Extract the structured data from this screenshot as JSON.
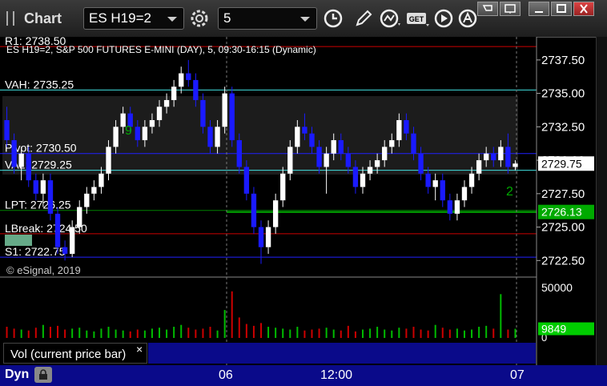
{
  "window": {
    "title": "Chart",
    "symbol": "ES H19=2",
    "interval": "5",
    "window_buttons": [
      "pin-icon",
      "restore-icon",
      "minimize-icon",
      "maximize-icon",
      "close-icon"
    ]
  },
  "toolbar": {
    "icons": [
      "settings-gear-icon",
      "clock-icon",
      "pencil-icon",
      "study-icon",
      "get-icon",
      "play-icon",
      "alert-icon"
    ],
    "get_label": "GET"
  },
  "chart": {
    "header": "ES H19=2, S&P 500 FUTURES E-MINI (DAY), 5, 09:30-16:15 (Dynamic)",
    "watermark": "© eSignal, 2019",
    "level_labels": [
      {
        "text": "R1: 2738.50",
        "price": 2738.5,
        "color": "#cc0000"
      },
      {
        "text": "VAH: 2735.25",
        "price": 2735.25,
        "color": "#40e0e0"
      },
      {
        "text": "Pivot: 2730.50",
        "price": 2730.5,
        "color": "#2020ff"
      },
      {
        "text": "VAL: 2729.25",
        "price": 2729.25,
        "color": "#40e0e0"
      },
      {
        "text": "LPT: 2726.25",
        "price": 2726.25,
        "color": "#008000"
      },
      {
        "text": "LBreak: 2724.50",
        "price": 2724.5,
        "color": "#cc0000"
      },
      {
        "text": "S1: 2722.75",
        "price": 2722.75,
        "color": "#2020ff"
      }
    ],
    "price_ticks": [
      "2737.50",
      "2735.00",
      "2732.50",
      "2730.00",
      "2727.50",
      "2725.00",
      "2722.50"
    ],
    "last_price": "2729.75",
    "green_level": "2726.13",
    "volume_tick": "50000",
    "volume_zero": "0",
    "volume_last": "9849",
    "time_ticks": [
      "06",
      "12:00",
      "07"
    ],
    "count_labels": [
      "9",
      "2"
    ]
  },
  "panel": {
    "vol_tab": "Vol (current price bar)",
    "close": "×",
    "dyn_label": "Dyn"
  },
  "chart_data": {
    "type": "candlestick",
    "y_range": [
      2721.5,
      2738.75
    ],
    "candles": [
      [
        2733,
        2734,
        2731,
        2731.5
      ],
      [
        2731.5,
        2732,
        2729,
        2729.5
      ],
      [
        2729.5,
        2731,
        2728.5,
        2730.5
      ],
      [
        2730.5,
        2731,
        2728,
        2728.5
      ],
      [
        2728.5,
        2729,
        2727,
        2727.5
      ],
      [
        2727.5,
        2729,
        2726.5,
        2728.5
      ],
      [
        2728.5,
        2729,
        2725.5,
        2726
      ],
      [
        2726,
        2726.5,
        2723,
        2723.5
      ],
      [
        2723.5,
        2724,
        2722.5,
        2723
      ],
      [
        2723,
        2725.5,
        2722.75,
        2725
      ],
      [
        2725,
        2727,
        2724.5,
        2726.5
      ],
      [
        2726.5,
        2728,
        2726,
        2727.5
      ],
      [
        2727.5,
        2728.5,
        2727,
        2728
      ],
      [
        2728,
        2729.5,
        2727.5,
        2729
      ],
      [
        2729,
        2731.5,
        2728.5,
        2731
      ],
      [
        2731,
        2733,
        2730.5,
        2732.5
      ],
      [
        2732.5,
        2734,
        2732,
        2733.5
      ],
      [
        2733.5,
        2734,
        2732,
        2732.5
      ],
      [
        2732.5,
        2733,
        2731,
        2731.5
      ],
      [
        2731.5,
        2733,
        2731,
        2732.5
      ],
      [
        2732.5,
        2733.5,
        2732,
        2733
      ],
      [
        2733,
        2734.5,
        2732.5,
        2734
      ],
      [
        2734,
        2735,
        2733.5,
        2734.5
      ],
      [
        2734.5,
        2736,
        2734,
        2735.5
      ],
      [
        2735.5,
        2737,
        2735,
        2736.5
      ],
      [
        2736.5,
        2737.5,
        2735.5,
        2736
      ],
      [
        2736,
        2736.5,
        2734,
        2734.5
      ],
      [
        2734.5,
        2735,
        2732,
        2732.5
      ],
      [
        2732.5,
        2733,
        2730.5,
        2731
      ],
      [
        2731,
        2733,
        2730.5,
        2732.5
      ],
      [
        2732.5,
        2735.5,
        2732,
        2735
      ],
      [
        2735,
        2735.5,
        2731,
        2731.5
      ],
      [
        2731.5,
        2732,
        2729,
        2729.5
      ],
      [
        2729.5,
        2730,
        2727,
        2727.5
      ],
      [
        2727.5,
        2728,
        2724.5,
        2725
      ],
      [
        2725,
        2725.5,
        2722.25,
        2723.5
      ],
      [
        2723.5,
        2725.5,
        2723,
        2725
      ],
      [
        2725,
        2727.5,
        2724.5,
        2727
      ],
      [
        2727,
        2729.5,
        2726.5,
        2729
      ],
      [
        2729,
        2731.5,
        2728.5,
        2731
      ],
      [
        2731,
        2733,
        2730.5,
        2732.5
      ],
      [
        2732.5,
        2733.5,
        2731.5,
        2732
      ],
      [
        2732,
        2732.5,
        2730.5,
        2731
      ],
      [
        2731,
        2731.5,
        2729,
        2729.5
      ],
      [
        2729.5,
        2731,
        2727.5,
        2730.5
      ],
      [
        2730.5,
        2732,
        2730,
        2731.5
      ],
      [
        2731.5,
        2732,
        2730,
        2730.5
      ],
      [
        2730.5,
        2731,
        2729,
        2729.5
      ],
      [
        2729.5,
        2730,
        2727.5,
        2728
      ],
      [
        2728,
        2729.5,
        2727.5,
        2729
      ],
      [
        2729,
        2730,
        2728.5,
        2729.5
      ],
      [
        2729.5,
        2730.5,
        2729,
        2730
      ],
      [
        2730,
        2731.5,
        2729.5,
        2731
      ],
      [
        2731,
        2732,
        2730.5,
        2731.5
      ],
      [
        2731.5,
        2733.5,
        2731,
        2733
      ],
      [
        2733,
        2733.5,
        2731.5,
        2732
      ],
      [
        2732,
        2732.5,
        2730,
        2730.5
      ],
      [
        2730.5,
        2731,
        2728.5,
        2729
      ],
      [
        2729,
        2729.5,
        2727.5,
        2728
      ],
      [
        2728,
        2729,
        2727,
        2728.5
      ],
      [
        2728.5,
        2729,
        2726.5,
        2727
      ],
      [
        2727,
        2727.5,
        2725.5,
        2726
      ],
      [
        2726,
        2727.5,
        2725.5,
        2727
      ],
      [
        2727,
        2728.5,
        2726.5,
        2728
      ],
      [
        2728,
        2729.5,
        2727.5,
        2729
      ],
      [
        2729,
        2730.5,
        2728.5,
        2730
      ],
      [
        2730,
        2731,
        2729.5,
        2730.5
      ],
      [
        2730.5,
        2731,
        2729.5,
        2730
      ],
      [
        2730,
        2731.5,
        2729.5,
        2731
      ],
      [
        2731,
        2732,
        2729,
        2729.5
      ],
      [
        2729.5,
        2730,
        2729.25,
        2729.75
      ]
    ],
    "volume": [
      12000,
      10000,
      9000,
      8000,
      11000,
      14000,
      12000,
      13000,
      9000,
      10000,
      11000,
      8000,
      7000,
      10000,
      12000,
      9000,
      8000,
      7000,
      9000,
      8000,
      10000,
      11000,
      9000,
      12000,
      14000,
      11000,
      9000,
      10000,
      12000,
      8000,
      30000,
      50000,
      22000,
      15000,
      13000,
      16000,
      12000,
      11000,
      10000,
      9000,
      12000,
      8000,
      9000,
      10000,
      11000,
      9000,
      8000,
      13000,
      7000,
      9000,
      10000,
      12000,
      9000,
      8000,
      11000,
      10000,
      12000,
      9000,
      8000,
      14000,
      11000,
      9000,
      10000,
      8000,
      9000,
      12000,
      13000,
      10000,
      47000,
      9000,
      9849
    ]
  }
}
